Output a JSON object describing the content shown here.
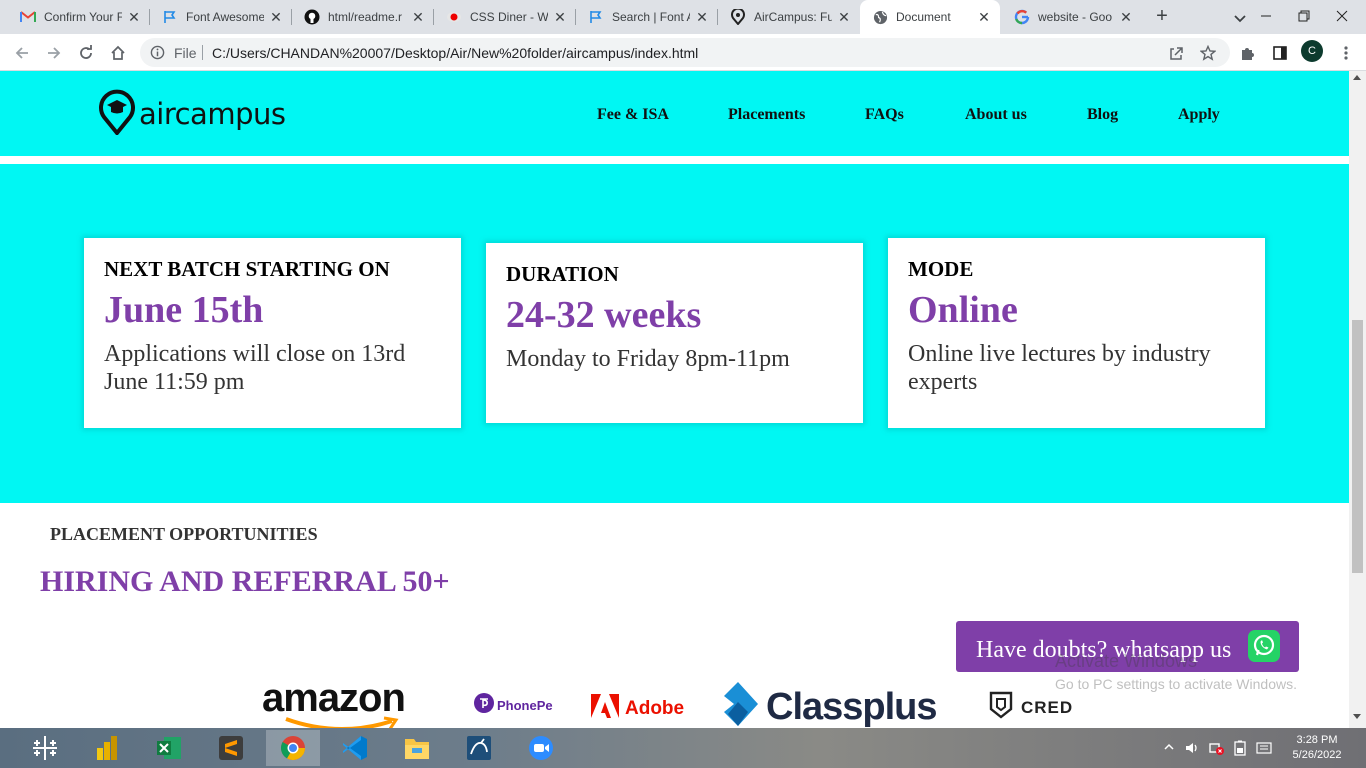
{
  "browser": {
    "tabs": [
      {
        "title": "Confirm Your F",
        "favicon": "gmail-icon"
      },
      {
        "title": "Font Awesome",
        "favicon": "flag-icon"
      },
      {
        "title": "html/readme.r",
        "favicon": "github-icon"
      },
      {
        "title": "CSS Diner - W",
        "favicon": "css-diner-icon"
      },
      {
        "title": "Search | Font A",
        "favicon": "flag-icon"
      },
      {
        "title": "AirCampus: Fu",
        "favicon": "aircampus-icon"
      },
      {
        "title": "Document",
        "favicon": "globe-icon",
        "active": true
      },
      {
        "title": "website - Goo",
        "favicon": "google-icon"
      }
    ],
    "address_bar": {
      "scheme_label": "File",
      "url": "C:/Users/CHANDAN%20007/Desktop/Air/New%20folder/aircampus/index.html"
    },
    "profile_initial": "C"
  },
  "site": {
    "brand": "aircampus",
    "nav": [
      "Fee & ISA",
      "Placements",
      "FAQs",
      "About us",
      "Blog",
      "Apply"
    ],
    "colors": {
      "header_bg": "#00f7f3",
      "accent": "#7f3fa8"
    },
    "info_cards": [
      {
        "label": "NEXT BATCH STARTING ON",
        "value": "June 15th",
        "description": "Applications will close on 13rd June 11:59 pm"
      },
      {
        "label": "DURATION",
        "value": "24-32 weeks",
        "description": "Monday to Friday 8pm-11pm"
      },
      {
        "label": "MODE",
        "value": "Online",
        "description": "Online live lectures by industry experts"
      }
    ],
    "placement": {
      "eyebrow": "PLACEMENT OPPORTUNITIES",
      "title": "HIRING AND REFERRAL 50+"
    },
    "partners": [
      "amazon",
      "PhonePe",
      "Adobe",
      "Classplus",
      "CRED"
    ],
    "whatsapp_cta": "Have doubts? whatsapp us"
  },
  "os": {
    "watermark": {
      "title": "Activate Windows",
      "subtitle": "Go to PC settings to activate Windows."
    },
    "clock": {
      "time": "3:28 PM",
      "date": "5/26/2022"
    }
  }
}
